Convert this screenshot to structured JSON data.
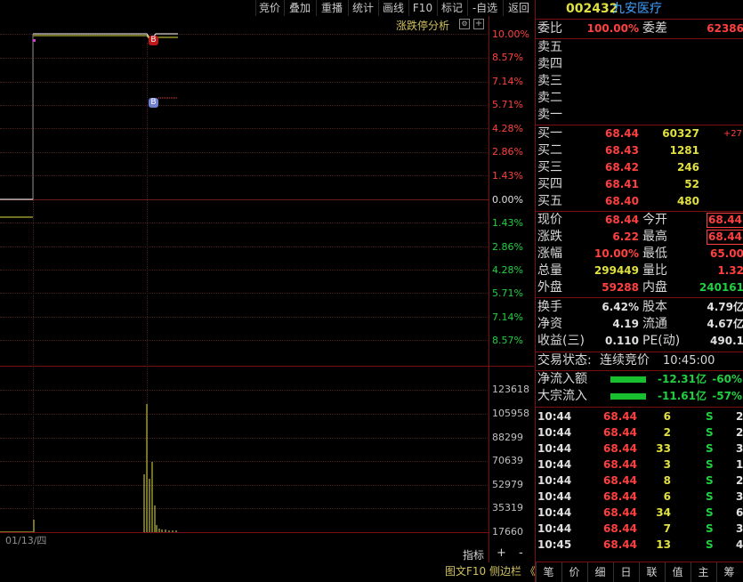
{
  "toolbar": {
    "items": [
      "竞价",
      "叠加",
      "重播",
      "统计",
      "画线",
      "F10",
      "标记",
      "-自选",
      "返回"
    ]
  },
  "chart": {
    "analysis_label": "涨跌停分析",
    "pct_labels_up": [
      "10.00%",
      "8.57%",
      "7.14%",
      "5.71%",
      "4.28%",
      "2.86%",
      "1.43%"
    ],
    "pct_zero": "0.00%",
    "pct_labels_down": [
      "1.43%",
      "2.86%",
      "4.28%",
      "5.71%",
      "7.14%",
      "8.57%"
    ],
    "marker_b": "B",
    "vol_labels": [
      "123618",
      "105958",
      "88299",
      "70639",
      "52979",
      "35319",
      "17660"
    ],
    "date_label": "01/13/四",
    "btn_indicator": "指标",
    "btn_plus": "+",
    "btn_minus": "-",
    "btn_f10": "图文F10",
    "btn_side": "侧边栏",
    "btn_collapse": "《"
  },
  "stock": {
    "code": "002432",
    "name": "九安医疗"
  },
  "book": {
    "weibi_label": "委比",
    "weibi": "100.00%",
    "weicha_label": "委差",
    "weicha": "62386",
    "sells": [
      "卖五",
      "卖四",
      "卖三",
      "卖二",
      "卖一"
    ],
    "buys": [
      {
        "label": "买一",
        "price": "68.44",
        "vol": "60327",
        "chg": "+27"
      },
      {
        "label": "买二",
        "price": "68.43",
        "vol": "1281",
        "chg": ""
      },
      {
        "label": "买三",
        "price": "68.42",
        "vol": "246",
        "chg": ""
      },
      {
        "label": "买四",
        "price": "68.41",
        "vol": "52",
        "chg": ""
      },
      {
        "label": "买五",
        "price": "68.40",
        "vol": "480",
        "chg": ""
      }
    ]
  },
  "quote": {
    "rows": [
      {
        "l1": "现价",
        "v1": "68.44",
        "l2": "今开",
        "v2": "68.44"
      },
      {
        "l1": "涨跌",
        "v1": "6.22",
        "l2": "最高",
        "v2": "68.44"
      },
      {
        "l1": "涨幅",
        "v1": "10.00%",
        "l2": "最低",
        "v2": "65.00"
      },
      {
        "l1": "总量",
        "v1": "299449",
        "l2": "量比",
        "v2": "1.32"
      },
      {
        "l1": "外盘",
        "v1": "59288",
        "l2": "内盘",
        "v2": "240161"
      }
    ],
    "rows2": [
      {
        "l1": "换手",
        "v1": "6.42%",
        "l2": "股本",
        "v2": "4.79亿"
      },
      {
        "l1": "净资",
        "v1": "4.19",
        "l2": "流通",
        "v2": "4.67亿"
      },
      {
        "l1": "收益(三)",
        "v1": "0.110",
        "l2": "PE(动)",
        "v2": "490.1"
      }
    ]
  },
  "status": {
    "label": "交易状态:",
    "value": "连续竞价",
    "time": "10:45:00"
  },
  "flow": [
    {
      "label": "净流入额",
      "value": "-12.31亿",
      "pct": "-60%"
    },
    {
      "label": "大宗流入",
      "value": "-11.61亿",
      "pct": "-57%"
    }
  ],
  "trades": [
    {
      "t": "10:44",
      "p": "68.44",
      "v": "6",
      "s": "S",
      "n": "2"
    },
    {
      "t": "10:44",
      "p": "68.44",
      "v": "2",
      "s": "S",
      "n": "2"
    },
    {
      "t": "10:44",
      "p": "68.44",
      "v": "33",
      "s": "S",
      "n": "3"
    },
    {
      "t": "10:44",
      "p": "68.44",
      "v": "3",
      "s": "S",
      "n": "1"
    },
    {
      "t": "10:44",
      "p": "68.44",
      "v": "8",
      "s": "S",
      "n": "2"
    },
    {
      "t": "10:44",
      "p": "68.44",
      "v": "6",
      "s": "S",
      "n": "3"
    },
    {
      "t": "10:44",
      "p": "68.44",
      "v": "34",
      "s": "S",
      "n": "6"
    },
    {
      "t": "10:44",
      "p": "68.44",
      "v": "7",
      "s": "S",
      "n": "3"
    },
    {
      "t": "10:45",
      "p": "68.44",
      "v": "13",
      "s": "S",
      "n": "4"
    }
  ],
  "bottom_tabs": [
    "笔",
    "价",
    "细",
    "日",
    "联",
    "值",
    "主",
    "筹"
  ],
  "colors": {
    "up": "#ff4040",
    "down": "#20d040",
    "volume": "#e0e040",
    "price_line": "#ffffff",
    "border": "#7a1010"
  }
}
